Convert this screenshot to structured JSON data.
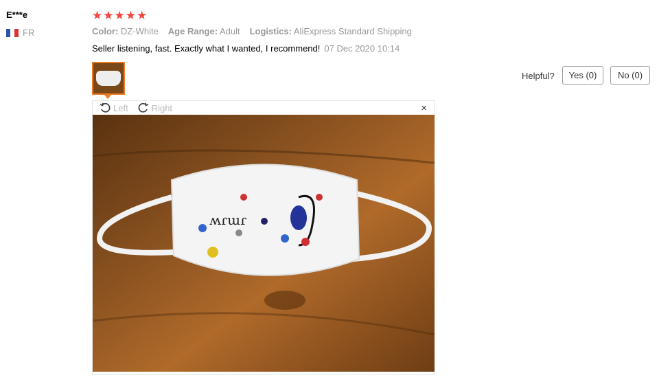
{
  "review": {
    "user": "E***e",
    "country": "FR",
    "stars": 5,
    "color_key": "Color:",
    "color_value": "DZ-White",
    "age_key": "Age Range:",
    "age_value": "Adult",
    "logistics_key": "Logistics:",
    "logistics_value": "AliExpress Standard Shipping",
    "text": "Seller listening, fast. Exactly what I wanted, I recommend!",
    "date": "07 Dec 2020 10:14"
  },
  "feedback": {
    "helpful_label": "Helpful?",
    "yes_label": "Yes (0)",
    "no_label": "No (0)"
  },
  "viewer": {
    "rotate_left": "Left",
    "rotate_right": "Right",
    "close": "×"
  },
  "colors": {
    "star": "#f0483e",
    "thumb_border": "#f07b24"
  }
}
